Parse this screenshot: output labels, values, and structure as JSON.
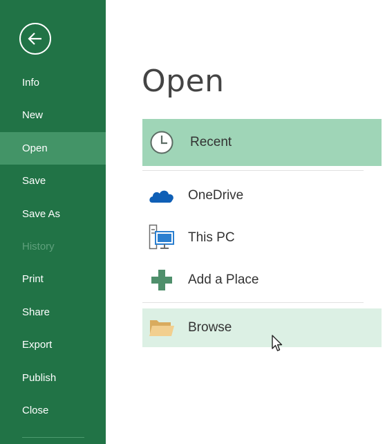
{
  "sidebar": {
    "back_icon": "back-arrow-icon",
    "items": [
      {
        "label": "Info",
        "state": "normal"
      },
      {
        "label": "New",
        "state": "normal"
      },
      {
        "label": "Open",
        "state": "active"
      },
      {
        "label": "Save",
        "state": "normal"
      },
      {
        "label": "Save As",
        "state": "normal"
      },
      {
        "label": "History",
        "state": "disabled"
      },
      {
        "label": "Print",
        "state": "normal"
      },
      {
        "label": "Share",
        "state": "normal"
      },
      {
        "label": "Export",
        "state": "normal"
      },
      {
        "label": "Publish",
        "state": "normal"
      },
      {
        "label": "Close",
        "state": "normal"
      }
    ]
  },
  "main": {
    "title": "Open",
    "locations": [
      {
        "label": "Recent",
        "icon": "clock-icon",
        "state": "selected"
      },
      {
        "label": "OneDrive",
        "icon": "cloud-icon",
        "state": "normal"
      },
      {
        "label": "This PC",
        "icon": "computer-icon",
        "state": "normal"
      },
      {
        "label": "Add a Place",
        "icon": "plus-icon",
        "state": "normal"
      },
      {
        "label": "Browse",
        "icon": "folder-icon",
        "state": "hover"
      }
    ]
  },
  "colors": {
    "sidebar_bg": "#217346",
    "sidebar_active": "#439467",
    "selected_bg": "#9fd5b7",
    "hover_bg": "#dcf0e4",
    "cloud_blue": "#0f5fb6",
    "plus_green": "#4f8f6b",
    "folder_tan": "#e8c58a"
  }
}
